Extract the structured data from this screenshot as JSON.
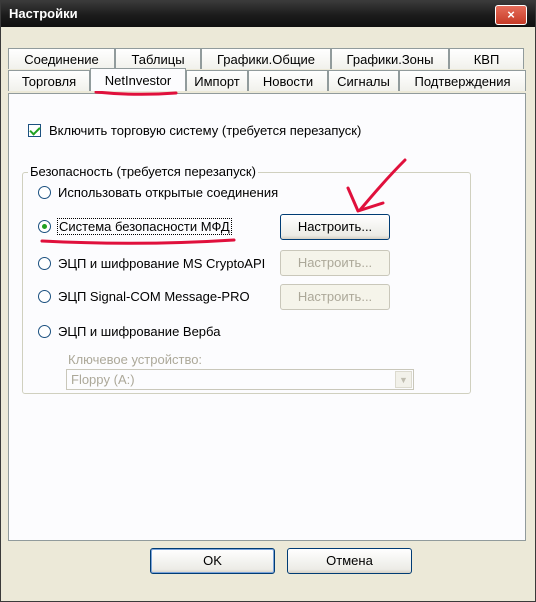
{
  "window": {
    "title": "Настройки",
    "close_label": "×"
  },
  "tabs": {
    "row1": [
      "Соединение",
      "Таблицы",
      "Графики.Общие",
      "Графики.Зоны",
      "КВП"
    ],
    "row2": [
      "Торговля",
      "NetInvestor",
      "Импорт",
      "Новости",
      "Сигналы",
      "Подтверждения"
    ],
    "active": "NetInvestor"
  },
  "trading_system": {
    "label": "Включить торговую систему (требуется перезапуск)",
    "checked": true
  },
  "security": {
    "group_label": "Безопасность (требуется перезапуск)",
    "options": [
      {
        "label": "Использовать открытые соединения",
        "selected": false
      },
      {
        "label": "Система безопасности МФД",
        "selected": true
      },
      {
        "label": "ЭЦП и шифрование MS CryptoAPI",
        "selected": false
      },
      {
        "label": "ЭЦП Signal-COM Message-PRO",
        "selected": false
      },
      {
        "label": "ЭЦП и шифрование Верба",
        "selected": false
      }
    ],
    "configure_label": "Настроить...",
    "key_device_label": "Ключевое устройство:",
    "key_device_value": "Floppy (A:)"
  },
  "footer": {
    "ok_label": "OK",
    "cancel_label": "Отмена"
  },
  "colors": {
    "annotation": "#e0103c",
    "title_bar": "#1b1b1b",
    "close_button": "#c63a26"
  }
}
